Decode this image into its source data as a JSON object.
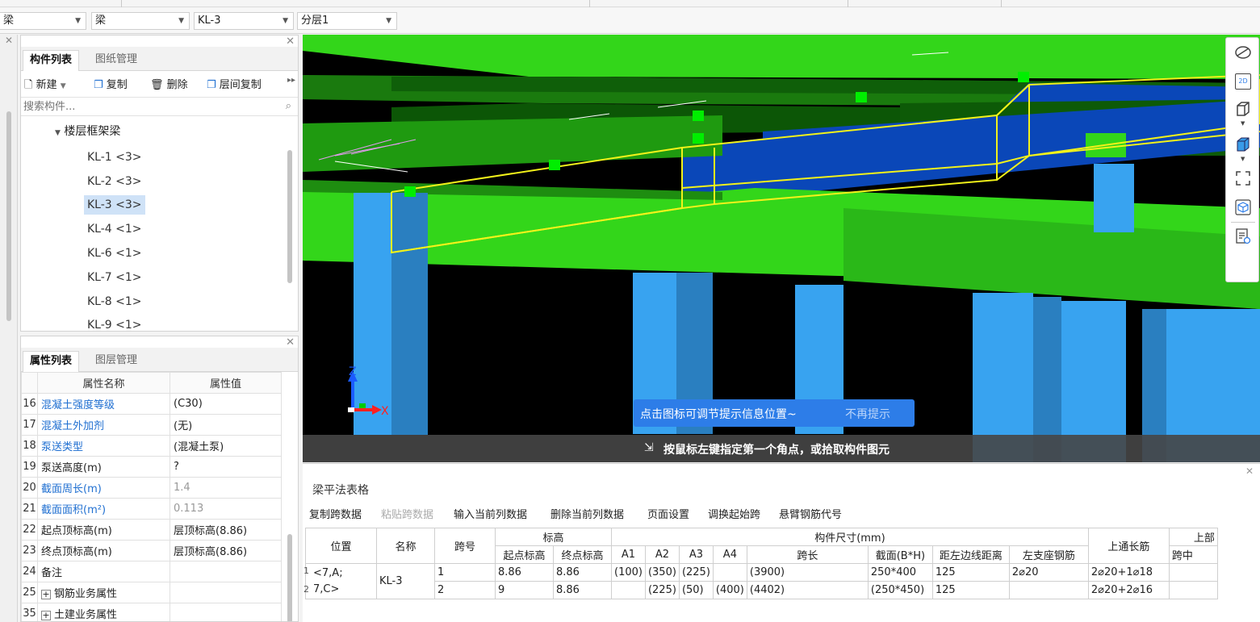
{
  "toolbar": {
    "dd1": "梁",
    "dd2": "梁",
    "dd3": "KL-3",
    "dd4": "分层1"
  },
  "component_panel": {
    "tabs": [
      "构件列表",
      "图纸管理"
    ],
    "actions": {
      "new": "新建",
      "copy": "复制",
      "delete": "删除",
      "floor_copy": "层间复制"
    },
    "search_placeholder": "搜索构件...",
    "group": "楼层框架梁",
    "items": [
      "KL-1 <3>",
      "KL-2 <3>",
      "KL-3 <3>",
      "KL-4 <1>",
      "KL-6 <1>",
      "KL-7 <1>",
      "KL-8 <1>",
      "KL-9 <1>"
    ],
    "selected": "KL-3 <3>"
  },
  "property_panel": {
    "tabs": [
      "属性列表",
      "图层管理"
    ],
    "header": {
      "name": "属性名称",
      "value": "属性值"
    },
    "rows": [
      {
        "no": "16",
        "name": "混凝土强度等级",
        "value": "(C30)",
        "blue": true
      },
      {
        "no": "17",
        "name": "混凝土外加剂",
        "value": "(无)",
        "blue": true
      },
      {
        "no": "18",
        "name": "泵送类型",
        "value": "(混凝土泵)",
        "blue": true
      },
      {
        "no": "19",
        "name": "泵送高度(m)",
        "value": "?",
        "blue": false
      },
      {
        "no": "20",
        "name": "截面周长(m)",
        "value": "1.4",
        "blue": true,
        "grey": true
      },
      {
        "no": "21",
        "name": "截面面积(m²)",
        "value": "0.113",
        "blue": true,
        "grey": true
      },
      {
        "no": "22",
        "name": "起点顶标高(m)",
        "value": "层顶标高(8.86)",
        "blue": false
      },
      {
        "no": "23",
        "name": "终点顶标高(m)",
        "value": "层顶标高(8.86)",
        "blue": false
      },
      {
        "no": "24",
        "name": "备注",
        "value": "",
        "blue": false
      },
      {
        "no": "25",
        "name": "钢筋业务属性",
        "value": "",
        "blue": false,
        "plus": true
      },
      {
        "no": "35",
        "name": "土建业务属性",
        "value": "",
        "blue": false,
        "plus": true
      }
    ]
  },
  "viewport": {
    "hint_text": "点击图标可调节提示信息位置~",
    "hint_dismiss": "不再提示",
    "status_text": "按鼠标左键指定第一个角点，或拾取构件图元",
    "axis_z": "Z",
    "axis_x": "X",
    "tool_icons": [
      "orbit-icon",
      "2d-view-icon",
      "3d-box-icon",
      "solid-box-icon",
      "fullscreen-icon",
      "layer-box-icon",
      "display-settings-icon"
    ],
    "tool_2d_label": "2D",
    "colors": {
      "slab": "#33d61a",
      "beam_blue": "#0a47b8",
      "column": "#38a3f0",
      "highlight": "#f2f21a"
    }
  },
  "bottom_panel": {
    "title": "梁平法表格",
    "actions": [
      "复制跨数据",
      "粘贴跨数据",
      "输入当前列数据",
      "删除当前列数据",
      "页面设置",
      "调换起始跨",
      "悬臂钢筋代号"
    ],
    "disabled_action": "粘贴跨数据",
    "table": {
      "h_position": "位置",
      "h_name": "名称",
      "h_span": "跨号",
      "h_elev": "标高",
      "h_elev_start": "起点标高",
      "h_elev_end": "终点标高",
      "h_dims": "构件尺寸(mm)",
      "h_a1": "A1",
      "h_a2": "A2",
      "h_a3": "A3",
      "h_a4": "A4",
      "h_len": "跨长",
      "h_sect": "截面(B*H)",
      "h_dist": "距左边线距离",
      "h_top": "上通长筋",
      "h_upper": "上部",
      "h_left": "左支座钢筋",
      "h_mid": "跨中",
      "position_lines": [
        "<7,A;",
        "7,C>"
      ],
      "row_nums": [
        "1",
        "2"
      ],
      "name": "KL-3",
      "rows": [
        {
          "span": "1",
          "start": "8.86",
          "end": "8.86",
          "a1": "(100)",
          "a2": "(350)",
          "a3": "(225)",
          "a4": "",
          "len": "(3900)",
          "sect": "250*400",
          "dist": "125",
          "top": "2⌀20",
          "left": "2⌀20+1⌀18"
        },
        {
          "span": "2",
          "start": "9",
          "end": "8.86",
          "a1": "",
          "a2": "(225)",
          "a3": "(50)",
          "a4": "(400)",
          "len": "(4402)",
          "sect": "(250*450)",
          "dist": "125",
          "top": "",
          "left": "2⌀20+2⌀16"
        }
      ]
    }
  }
}
